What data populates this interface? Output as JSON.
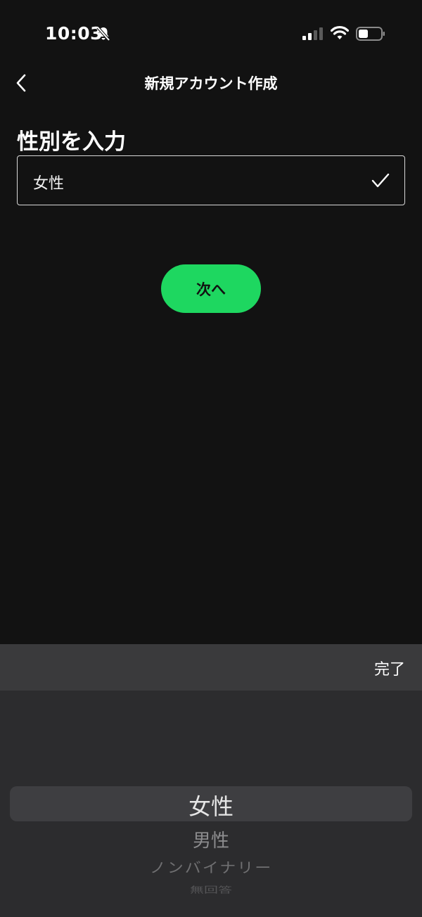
{
  "status_bar": {
    "time": "10:03",
    "icons": [
      "bell-slash-icon",
      "cellular-signal-icon",
      "wifi-icon",
      "battery-icon"
    ]
  },
  "nav": {
    "title": "新規アカウント作成",
    "back_icon": "chevron-left-icon"
  },
  "form": {
    "heading": "性別を入力",
    "selected_value": "女性",
    "check_icon": "checkmark-icon"
  },
  "next_button": {
    "label": "次へ"
  },
  "picker": {
    "done_label": "完了",
    "options": [
      "女性",
      "男性",
      "ノンバイナリー",
      "無回答"
    ],
    "selected_index": 0
  },
  "colors": {
    "background": "#121212",
    "accent": "#1ed760",
    "picker_bg": "#2c2c2e",
    "toolbar_bg": "#3a3a3c"
  }
}
